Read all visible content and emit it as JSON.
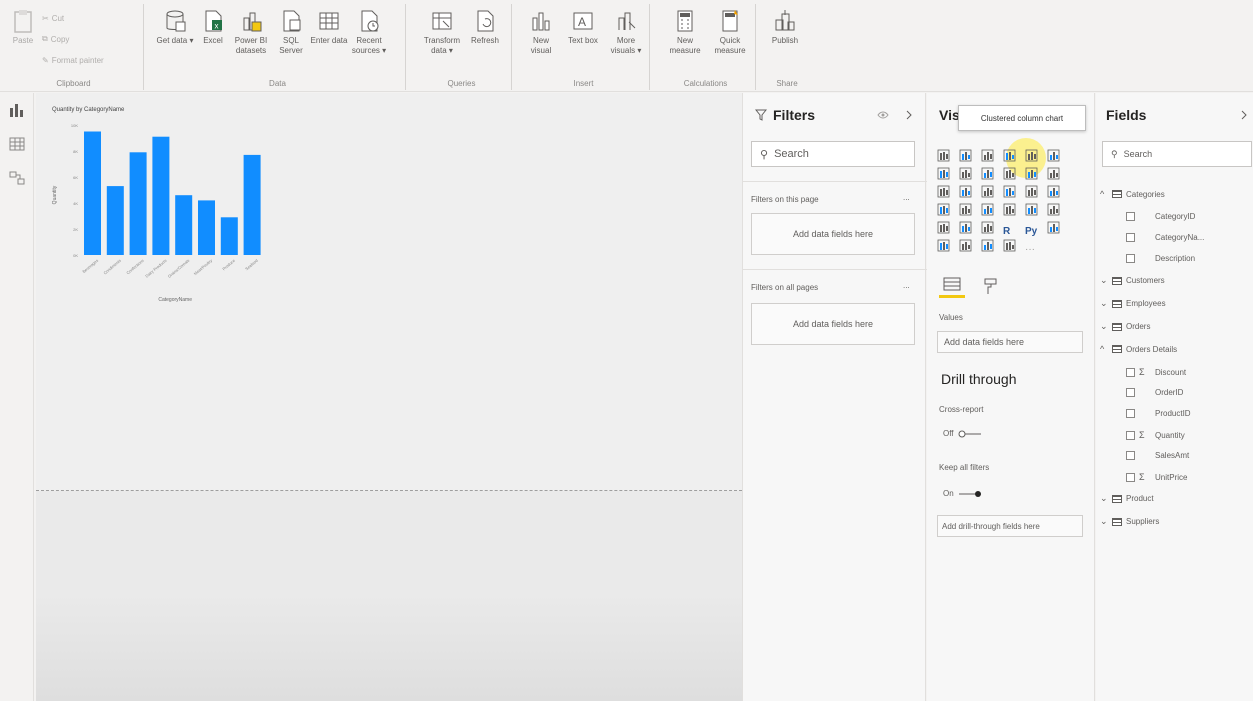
{
  "ribbon": {
    "clipboard": {
      "paste": "Paste",
      "cut": "Cut",
      "copy": "Copy",
      "format_painter": "Format painter",
      "label": "Clipboard"
    },
    "data": {
      "label": "Data",
      "buttons": [
        "Get data ▾",
        "Excel",
        "Power BI datasets",
        "SQL Server",
        "Enter data",
        "Recent sources ▾"
      ]
    },
    "queries": {
      "label": "Queries",
      "buttons": [
        "Transform data ▾",
        "Refresh"
      ]
    },
    "insert": {
      "label": "Insert",
      "buttons": [
        "New visual",
        "Text box",
        "More visuals ▾"
      ]
    },
    "calculations": {
      "label": "Calculations",
      "buttons": [
        "New measure",
        "Quick measure"
      ]
    },
    "share": {
      "label": "Share",
      "buttons": [
        "Publish"
      ]
    }
  },
  "chart": {
    "title": "Quantity by CategoryName",
    "xlabel": "CategoryName",
    "ylabel": "Quantity",
    "bar_color": "#118dff"
  },
  "chart_data": {
    "type": "bar",
    "title": "Quantity by CategoryName",
    "xlabel": "CategoryName",
    "ylabel": "Quantity",
    "categories": [
      "Beverages",
      "Condiments",
      "Confections",
      "Dairy Products",
      "Grains/Cereals",
      "Meat/Poultry",
      "Produce",
      "Seafood"
    ],
    "values": [
      9500,
      5300,
      7900,
      9100,
      4600,
      4200,
      2900,
      7700
    ],
    "ylim": [
      0,
      10000
    ],
    "yticks": [
      "10K",
      "8K",
      "6K",
      "4K",
      "2K",
      "0K"
    ],
    "grid": false,
    "legend": "none"
  },
  "filters": {
    "title": "Filters",
    "search_placeholder": "Search",
    "on_page_label": "Filters on this page",
    "on_all_pages_label": "Filters on all pages",
    "add_fields": "Add data fields here",
    "more": "..."
  },
  "visualizations": {
    "title_visible": "Vis",
    "tooltip": "Clustered column chart",
    "values_label": "Values",
    "add_fields": "Add data fields here",
    "drill_through_title": "Drill through",
    "cross_report_label": "Cross-report",
    "cross_report_state": "Off",
    "keep_filters_label": "Keep all filters",
    "keep_filters_state": "On",
    "add_drill_fields": "Add drill-through fields here",
    "r_label": "R",
    "py_label": "Py",
    "more_label": "···"
  },
  "fields": {
    "title": "Fields",
    "search_placeholder": "Search",
    "tables": [
      {
        "name": "Categories",
        "expanded": true,
        "columns": [
          {
            "name": "CategoryID",
            "sigma": false
          },
          {
            "name": "CategoryNa...",
            "sigma": false
          },
          {
            "name": "Description",
            "sigma": false
          }
        ]
      },
      {
        "name": "Customers",
        "expanded": false
      },
      {
        "name": "Employees",
        "expanded": false
      },
      {
        "name": "Orders",
        "expanded": false
      },
      {
        "name": "Orders Details",
        "expanded": true,
        "columns": [
          {
            "name": "Discount",
            "sigma": true
          },
          {
            "name": "OrderID",
            "sigma": false
          },
          {
            "name": "ProductID",
            "sigma": false
          },
          {
            "name": "Quantity",
            "sigma": true
          },
          {
            "name": "SalesAmt",
            "sigma": false
          },
          {
            "name": "UnitPrice",
            "sigma": true
          }
        ]
      },
      {
        "name": "Product",
        "expanded": false
      },
      {
        "name": "Suppliers",
        "expanded": false
      }
    ]
  }
}
